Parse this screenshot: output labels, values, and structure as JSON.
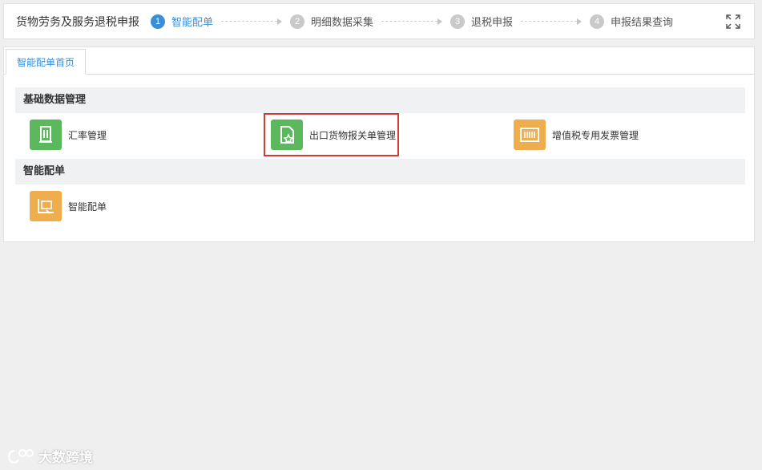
{
  "header": {
    "app_title": "货物劳务及服务退税申报",
    "steps": [
      {
        "num": "1",
        "label": "智能配单",
        "active": true
      },
      {
        "num": "2",
        "label": "明细数据采集",
        "active": false
      },
      {
        "num": "3",
        "label": "退税申报",
        "active": false
      },
      {
        "num": "4",
        "label": "申报结果查询",
        "active": false
      }
    ],
    "fullscreen_icon": "expand-icon"
  },
  "tabs": [
    {
      "label": "智能配单首页",
      "active": true
    }
  ],
  "sections": [
    {
      "title": "基础数据管理",
      "items": [
        {
          "label": "汇率管理",
          "icon": "document-icon",
          "color": "#5cb85c"
        },
        {
          "label": "出口货物报关单管理",
          "icon": "document-star-icon",
          "color": "#5cb85c",
          "highlighted": true
        },
        {
          "label": "增值税专用发票管理",
          "icon": "invoice-icon",
          "color": "#f0ad4e"
        }
      ]
    },
    {
      "title": "智能配单",
      "items": [
        {
          "label": "智能配单",
          "icon": "match-icon",
          "color": "#f0ad4e"
        }
      ]
    }
  ],
  "watermark": {
    "text": "大数跨境"
  }
}
